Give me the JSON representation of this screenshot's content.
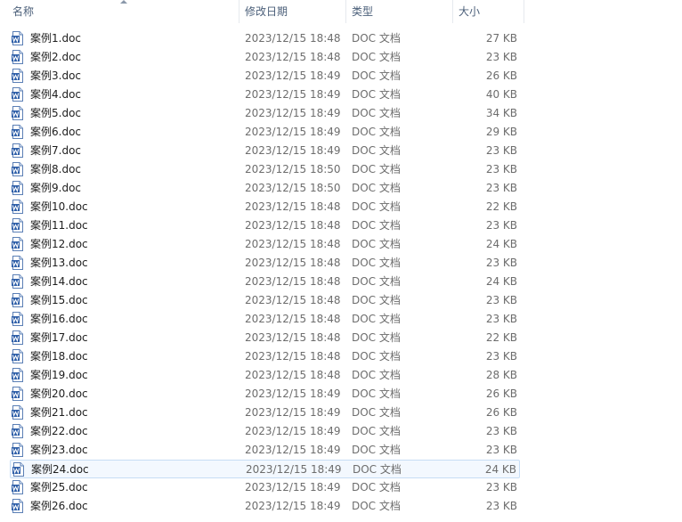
{
  "columns": {
    "name": "名称",
    "modified": "修改日期",
    "type": "类型",
    "size": "大小"
  },
  "sort": {
    "column": "name",
    "direction": "ascending"
  },
  "selected_index": 23,
  "files": [
    {
      "name": "案例1.doc",
      "modified": "2023/12/15 18:48",
      "type": "DOC 文档",
      "size": "27 KB"
    },
    {
      "name": "案例2.doc",
      "modified": "2023/12/15 18:48",
      "type": "DOC 文档",
      "size": "23 KB"
    },
    {
      "name": "案例3.doc",
      "modified": "2023/12/15 18:49",
      "type": "DOC 文档",
      "size": "26 KB"
    },
    {
      "name": "案例4.doc",
      "modified": "2023/12/15 18:49",
      "type": "DOC 文档",
      "size": "40 KB"
    },
    {
      "name": "案例5.doc",
      "modified": "2023/12/15 18:49",
      "type": "DOC 文档",
      "size": "34 KB"
    },
    {
      "name": "案例6.doc",
      "modified": "2023/12/15 18:49",
      "type": "DOC 文档",
      "size": "29 KB"
    },
    {
      "name": "案例7.doc",
      "modified": "2023/12/15 18:49",
      "type": "DOC 文档",
      "size": "23 KB"
    },
    {
      "name": "案例8.doc",
      "modified": "2023/12/15 18:50",
      "type": "DOC 文档",
      "size": "23 KB"
    },
    {
      "name": "案例9.doc",
      "modified": "2023/12/15 18:50",
      "type": "DOC 文档",
      "size": "23 KB"
    },
    {
      "name": "案例10.doc",
      "modified": "2023/12/15 18:48",
      "type": "DOC 文档",
      "size": "22 KB"
    },
    {
      "name": "案例11.doc",
      "modified": "2023/12/15 18:48",
      "type": "DOC 文档",
      "size": "23 KB"
    },
    {
      "name": "案例12.doc",
      "modified": "2023/12/15 18:48",
      "type": "DOC 文档",
      "size": "24 KB"
    },
    {
      "name": "案例13.doc",
      "modified": "2023/12/15 18:48",
      "type": "DOC 文档",
      "size": "23 KB"
    },
    {
      "name": "案例14.doc",
      "modified": "2023/12/15 18:48",
      "type": "DOC 文档",
      "size": "24 KB"
    },
    {
      "name": "案例15.doc",
      "modified": "2023/12/15 18:48",
      "type": "DOC 文档",
      "size": "23 KB"
    },
    {
      "name": "案例16.doc",
      "modified": "2023/12/15 18:48",
      "type": "DOC 文档",
      "size": "23 KB"
    },
    {
      "name": "案例17.doc",
      "modified": "2023/12/15 18:48",
      "type": "DOC 文档",
      "size": "22 KB"
    },
    {
      "name": "案例18.doc",
      "modified": "2023/12/15 18:48",
      "type": "DOC 文档",
      "size": "23 KB"
    },
    {
      "name": "案例19.doc",
      "modified": "2023/12/15 18:48",
      "type": "DOC 文档",
      "size": "28 KB"
    },
    {
      "name": "案例20.doc",
      "modified": "2023/12/15 18:49",
      "type": "DOC 文档",
      "size": "26 KB"
    },
    {
      "name": "案例21.doc",
      "modified": "2023/12/15 18:49",
      "type": "DOC 文档",
      "size": "26 KB"
    },
    {
      "name": "案例22.doc",
      "modified": "2023/12/15 18:49",
      "type": "DOC 文档",
      "size": "23 KB"
    },
    {
      "name": "案例23.doc",
      "modified": "2023/12/15 18:49",
      "type": "DOC 文档",
      "size": "23 KB"
    },
    {
      "name": "案例24.doc",
      "modified": "2023/12/15 18:49",
      "type": "DOC 文档",
      "size": "24 KB"
    },
    {
      "name": "案例25.doc",
      "modified": "2023/12/15 18:49",
      "type": "DOC 文档",
      "size": "23 KB"
    },
    {
      "name": "案例26.doc",
      "modified": "2023/12/15 18:49",
      "type": "DOC 文档",
      "size": "23 KB"
    }
  ],
  "icons": {
    "file": "word-document-icon"
  },
  "colors": {
    "header_text": "#4c607a",
    "selection_bg": "#f3f8fe",
    "selection_border": "#c7ddf5",
    "secondary_text": "#6d6d6d"
  }
}
